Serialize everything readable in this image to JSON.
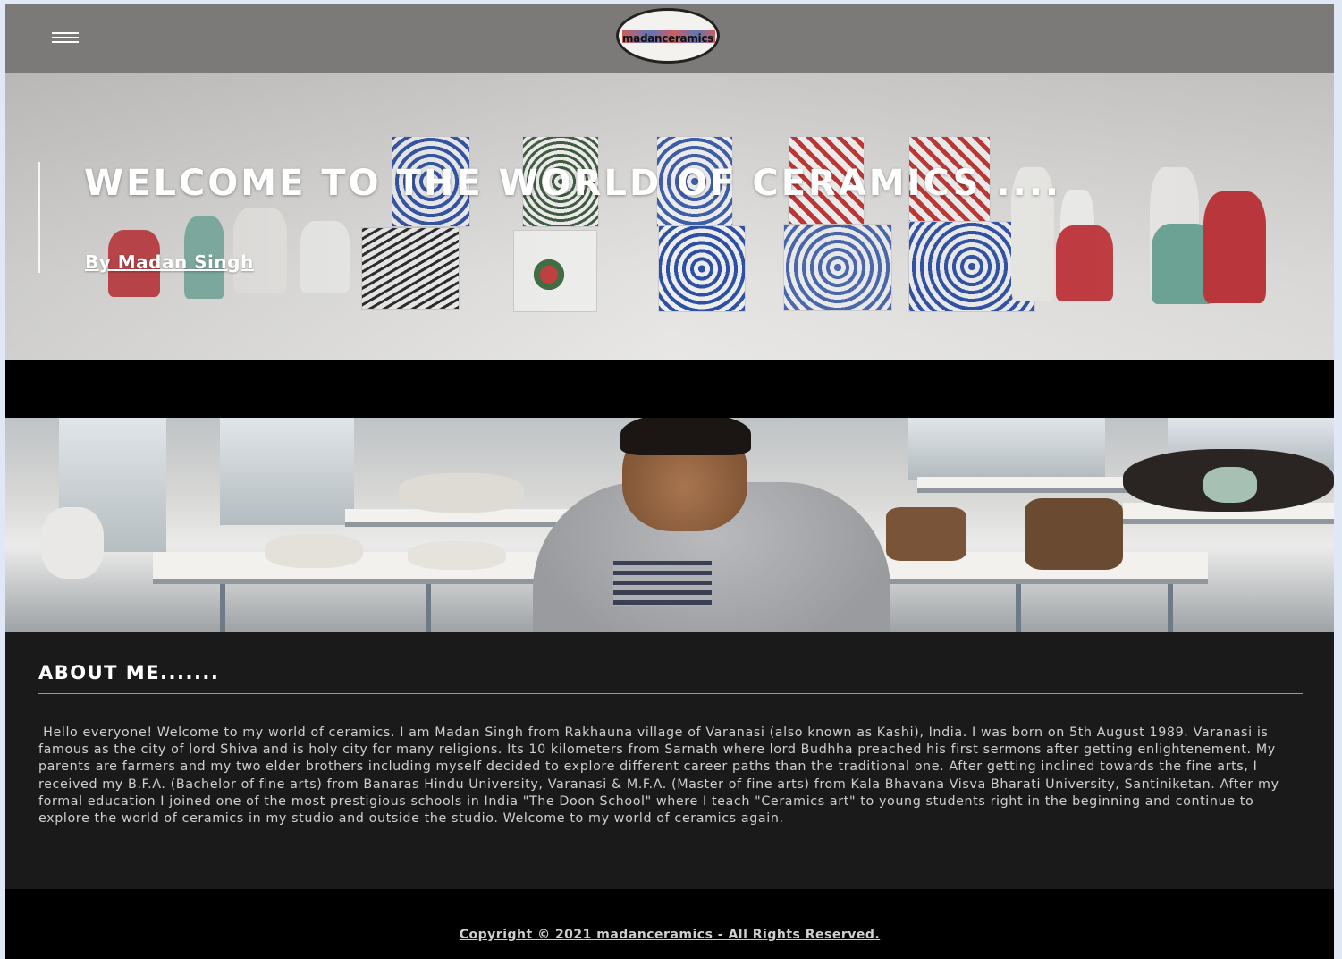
{
  "header": {
    "logo_text": "madanceramics",
    "menu_icon": "hamburger-menu-icon"
  },
  "hero": {
    "title": "WELCOME TO THE WORLD OF CERAMICS ....",
    "byline": "By Madan Singh"
  },
  "about": {
    "title": "ABOUT ME.......",
    "body": " Hello everyone! Welcome to my world of ceramics. I am Madan Singh from Rakhauna village of Varanasi (also known as Kashi), India. I was born on 5th August 1989. Varanasi is famous as the city of lord Shiva and is holy city for many religions. Its 10 kilometers from Sarnath where lord Budhha preached his first sermons after getting enlightenement. My parents are farmers and my two elder brothers including myself decided to explore different career paths than the traditional one. After getting inclined towards the fine arts, I received my B.F.A. (Bachelor of fine arts) from Banaras Hindu University, Varanasi & M.F.A. (Master of fine arts) from Kala Bhavana Visva Bharati University, Santiniketan. After my formal education I joined one of the most prestigious schools in India \"The Doon School\" where I teach \"Ceramics art\" to young students right in the beginning and continue to explore the world of ceramics in my studio and outside the studio. Welcome to my world of ceramics again."
  },
  "footer": {
    "copyright": "Copyright © 2021 madanceramics - All Rights Reserved."
  },
  "colors": {
    "header_bg": "#7b7a78",
    "about_bg": "#1a1a1a",
    "footer_bg": "#000000",
    "accent_red": "#c0312e",
    "accent_blue": "#2a4ea7"
  }
}
